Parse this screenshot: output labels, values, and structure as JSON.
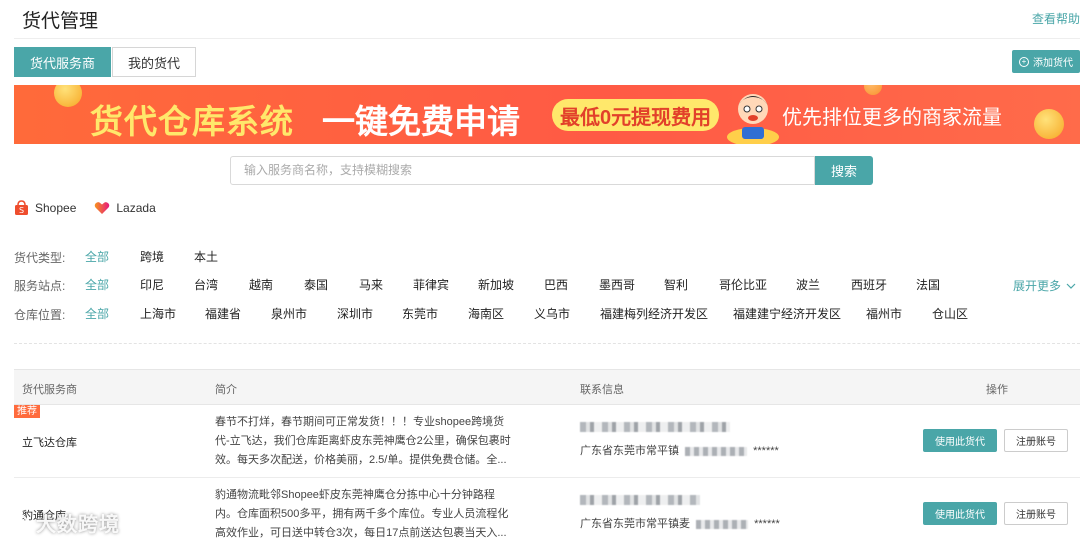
{
  "header": {
    "title": "货代管理",
    "help_link": "查看帮助"
  },
  "tabs": [
    {
      "label": "货代服务商",
      "active": true
    },
    {
      "label": "我的货代",
      "active": false
    }
  ],
  "add_button": {
    "label": "添加货代"
  },
  "banner": {
    "title": "货代仓库系统",
    "cta": "一键免费申请",
    "pill": "最低0元提现费用",
    "tail": "优先排位更多的商家流量"
  },
  "search": {
    "placeholder": "输入服务商名称，支持模糊搜索",
    "button": "搜索"
  },
  "platforms": [
    {
      "label": "Shopee",
      "icon": "shopee-bag-icon"
    },
    {
      "label": "Lazada",
      "icon": "lazada-heart-icon"
    }
  ],
  "filters": {
    "type": {
      "label": "货代类型:",
      "options": [
        "全部",
        "跨境",
        "本土"
      ]
    },
    "site": {
      "label": "服务站点:",
      "options": [
        "全部",
        "印尼",
        "台湾",
        "越南",
        "泰国",
        "马来",
        "菲律宾",
        "新加坡",
        "巴西",
        "墨西哥",
        "智利",
        "哥伦比亚",
        "波兰",
        "西班牙",
        "法国"
      ],
      "expand": "展开更多"
    },
    "location": {
      "label": "仓库位置:",
      "options": [
        "全部",
        "上海市",
        "福建省",
        "泉州市",
        "深圳市",
        "东莞市",
        "海南区",
        "义乌市",
        "福建梅列经济开发区",
        "福建建宁经济开发区",
        "福州市",
        "仓山区"
      ]
    }
  },
  "table": {
    "headers": [
      "货代服务商",
      "简介",
      "联系信息",
      "操作"
    ],
    "rows": [
      {
        "tag": "推荐",
        "name": "立飞达仓库",
        "intro": "春节不打烊，春节期间可正常发货！！！专业shopee跨境货代-立飞达，我们仓库距离虾皮东莞神鹰仓2公里，确保包裹时效。每天多次配送，价格美丽，2.5/单。提供免费仓储。全...",
        "address": "广东省东莞市常平镇",
        "masked": "******",
        "use_button": "使用此货代",
        "register_button": "注册账号"
      },
      {
        "tag": "",
        "name": "豹通仓库",
        "intro": "豹通物流毗邻Shopee虾皮东莞神鹰仓分拣中心十分钟路程内。仓库面积500多平，拥有两千多个库位。专业人员流程化高效作业，可日送中转仓3次，每日17点前送达包裹当天入...",
        "address": "广东省东莞市常平镇麦",
        "masked": "******",
        "use_button": "使用此货代",
        "register_button": "注册账号"
      }
    ]
  },
  "watermark": "大数跨境",
  "colors": {
    "accent": "#4aa6a8",
    "banner": "#ff5a45",
    "banner_yellow": "#ffe86b",
    "tag": "#ff6b3d"
  }
}
